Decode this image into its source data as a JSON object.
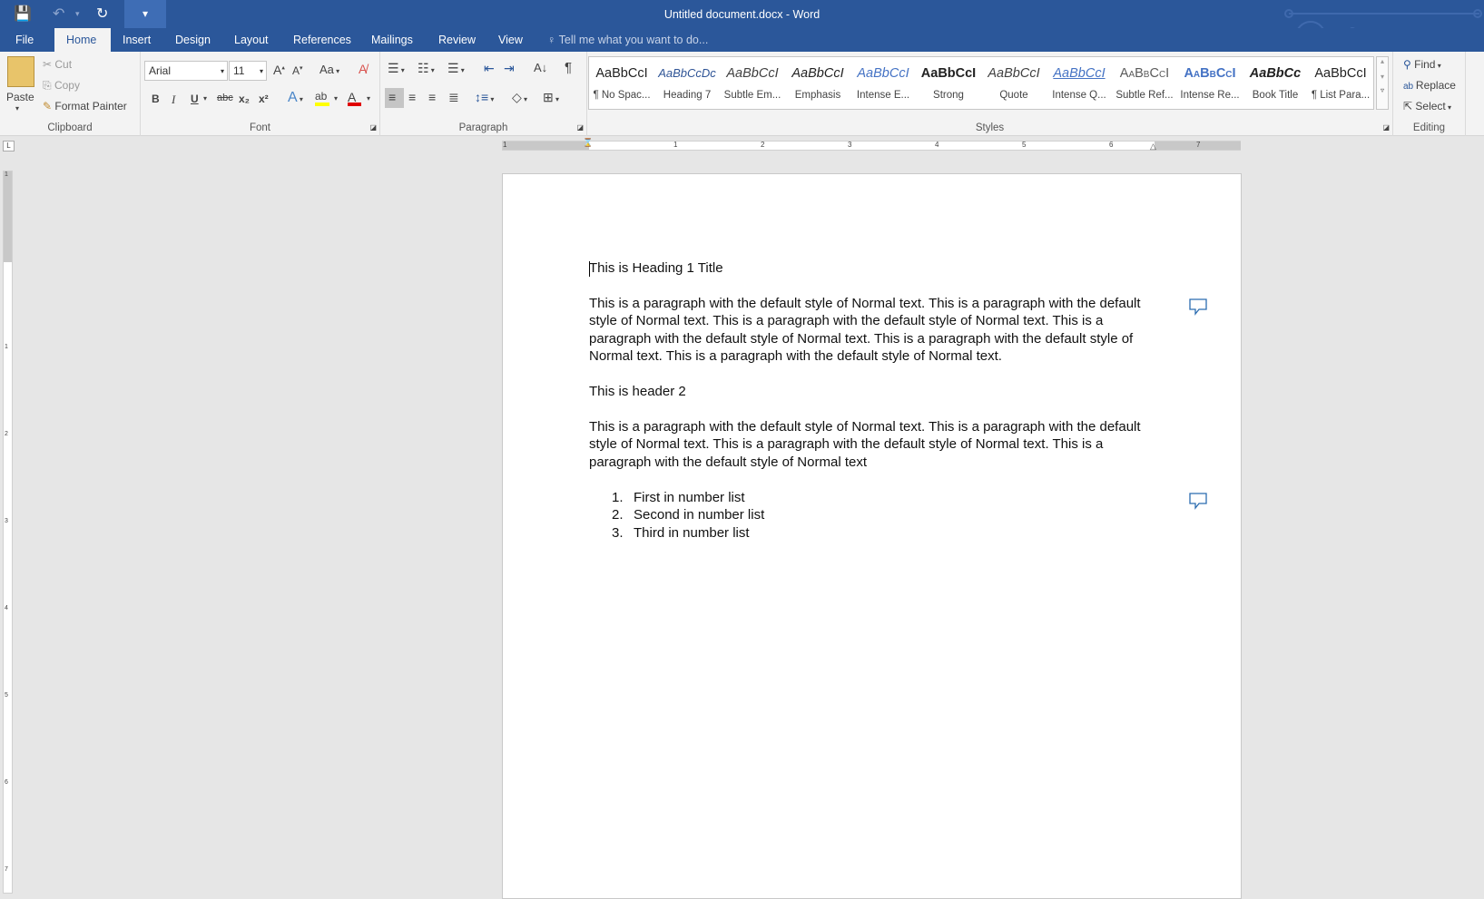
{
  "titlebar": {
    "title": "Untitled document.docx - Word",
    "icons": [
      "save-icon",
      "undo-icon",
      "redo-icon",
      "customize-qat-icon"
    ]
  },
  "tabs": [
    "File",
    "Home",
    "Insert",
    "Design",
    "Layout",
    "References",
    "Mailings",
    "Review",
    "View"
  ],
  "active_tab": "Home",
  "tell_me": "Tell me what you want to do...",
  "clipboard": {
    "paste": "Paste",
    "cut": "Cut",
    "copy": "Copy",
    "format_painter": "Format Painter",
    "label": "Clipboard"
  },
  "font": {
    "name": "Arial",
    "size": "11",
    "label": "Font",
    "bold": "B",
    "italic": "I",
    "underline": "U",
    "strike": "abc",
    "sub": "x₂",
    "sup": "x²",
    "case": "Aa",
    "highlight_color": "#ffff00",
    "font_color": "#e00000"
  },
  "paragraph": {
    "label": "Paragraph"
  },
  "styles": {
    "label": "Styles",
    "items": [
      {
        "preview": "AaBbCcI",
        "name": "¶ No Spac..."
      },
      {
        "preview": "AaBbCcDc",
        "name": "Heading 7"
      },
      {
        "preview": "AaBbCcI",
        "name": "Subtle Em..."
      },
      {
        "preview": "AaBbCcI",
        "name": "Emphasis"
      },
      {
        "preview": "AaBbCcI",
        "name": "Intense E..."
      },
      {
        "preview": "AaBbCcI",
        "name": "Strong"
      },
      {
        "preview": "AaBbCcI",
        "name": "Quote"
      },
      {
        "preview": "AaBbCcI",
        "name": "Intense Q..."
      },
      {
        "preview": "AaBbCcI",
        "name": "Subtle Ref..."
      },
      {
        "preview": "AaBbCcI",
        "name": "Intense Re..."
      },
      {
        "preview": "AaBbCc",
        "name": "Book Title"
      },
      {
        "preview": "AaBbCcI",
        "name": "¶ List Para..."
      }
    ]
  },
  "editing": {
    "find": "Find",
    "replace": "Replace",
    "select": "Select",
    "label": "Editing"
  },
  "ruler": {
    "h_ticks": [
      "1",
      "1",
      "2",
      "3",
      "4",
      "5",
      "6",
      "7"
    ],
    "v_ticks": [
      "1",
      "1",
      "2",
      "3",
      "4",
      "5",
      "6",
      "7"
    ]
  },
  "document": {
    "heading1": "This is Heading 1 Title",
    "para1": [
      "This is a paragraph with the default style of Normal text. This is a paragraph with the default",
      "style of Normal text. This is a paragraph with the default style of Normal text. This is a",
      "paragraph with the default style of Normal text. This is a paragraph with the default style of",
      "Normal text. This is a paragraph with the default style of Normal text."
    ],
    "heading2": "This is header 2",
    "para2": [
      "This is a paragraph with the default style of Normal text. This is a paragraph with the default",
      "style of Normal text. This is a paragraph with the default style of Normal text. This is a",
      "paragraph with the default style of Normal text"
    ],
    "list": [
      {
        "num": "1.",
        "text": "First in number list"
      },
      {
        "num": "2.",
        "text": "Second in number list"
      },
      {
        "num": "3.",
        "text": "Third in number list"
      }
    ]
  },
  "colors": {
    "brand": "#2b579a",
    "ribbon": "#f3f3f3",
    "canvas": "#e6e6e6",
    "comment_icon": "#2b6cb0"
  }
}
